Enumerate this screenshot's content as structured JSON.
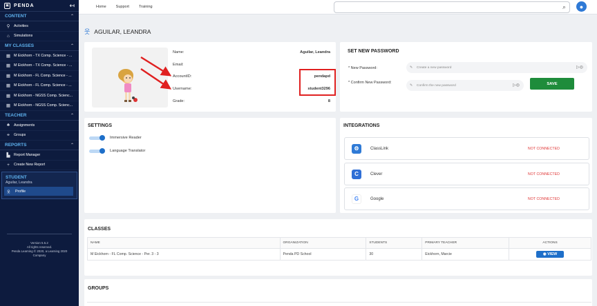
{
  "sidebar": {
    "brand": "PENDA",
    "sections": {
      "content": "CONTENT",
      "my_classes": "MY CLASSES",
      "teacher": "TEACHER",
      "reports": "REPORTS"
    },
    "content_items": [
      "Activities",
      "Simulations"
    ],
    "class_items": [
      "M Eickhorn - TX Comp. Science - ...",
      "M Eickhorn - TX Comp. Science - ...",
      "M Eickhorn - FL Comp. Science - ...",
      "M Eickhorn - FL Comp. Science - ...",
      "M Eickhorn - NGSS Comp. Scienc...",
      "M Eickhorn - NGSS Comp. Scienc..."
    ],
    "teacher_items": [
      "Assignments",
      "Groups"
    ],
    "report_items": [
      "Report Manager",
      "Create New Report"
    ],
    "student": {
      "title": "STUDENT",
      "name": "Aguilar, Leandra",
      "profile": "Profile"
    },
    "version": [
      "Version 5.5.2",
      "All rights reserved.",
      "Penda Learning © 2020, a Learning 2020 Company"
    ]
  },
  "topbar": {
    "nav": [
      "Home",
      "Support",
      "Training"
    ],
    "search_placeholder": ""
  },
  "page": {
    "title": "AGUILAR, LEANDRA"
  },
  "profile": {
    "fields": [
      {
        "label": "Name:",
        "value": "Aguilar, Leandra"
      },
      {
        "label": "Email:",
        "value": ""
      },
      {
        "label": "AccountID:",
        "value": "pendapd"
      },
      {
        "label": "Username:",
        "value": "student3296"
      },
      {
        "label": "Grade:",
        "value": "8"
      }
    ],
    "annotation_color": "#e02020"
  },
  "password": {
    "title": "SET NEW PASSWORD",
    "new_label": "* New Password:",
    "new_placeholder": "Create a new password",
    "confirm_label": "* Confirm New Password:",
    "confirm_placeholder": "Confirm the new password",
    "save": "SAVE"
  },
  "settings": {
    "title": "SETTINGS",
    "toggles": [
      "Immersive Reader",
      "Language Translator"
    ]
  },
  "integrations": {
    "title": "INTEGRATIONS",
    "items": [
      {
        "name": "ClassLink",
        "status": "NOT CONNECTED",
        "color": "#2f7ad6",
        "glyph": "⚙"
      },
      {
        "name": "Clever",
        "status": "NOT CONNECTED",
        "color": "#2f6fd6",
        "glyph": "C"
      },
      {
        "name": "Google",
        "status": "NOT CONNECTED",
        "color": "#ffffff",
        "glyph": "G"
      }
    ]
  },
  "classes": {
    "title": "CLASSES",
    "headers": [
      "NAME",
      "ORGANIZATION",
      "STUDENTS",
      "PRIMARY TEACHER",
      "ACTIONS"
    ],
    "rows": [
      {
        "name": "M Eickhorn - FL Comp. Science - Per. 3 - 3",
        "organization": "Penda PD School",
        "students": "30",
        "teacher": "Eickhorn, Marcie",
        "action": "VIEW"
      }
    ]
  },
  "groups": {
    "title": "GROUPS"
  }
}
